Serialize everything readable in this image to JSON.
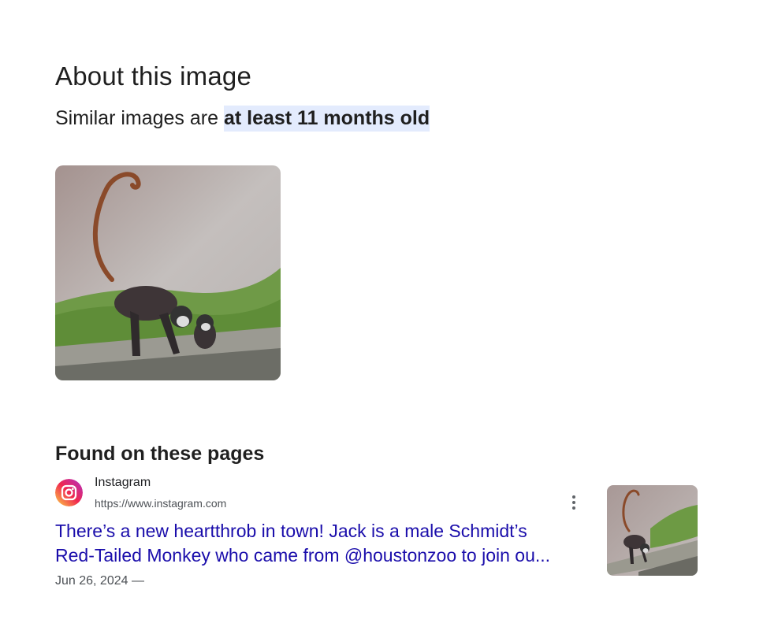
{
  "page": {
    "title": "About this image",
    "age_prefix": "Similar images are ",
    "age_highlight": "at least 11 months old",
    "found_title": "Found on these pages"
  },
  "main_image": {
    "icon": "monkey-photo"
  },
  "results": [
    {
      "source_name": "Instagram",
      "source_url": "https://www.instagram.com",
      "favicon": "instagram-icon",
      "title_line1": "There’s a new heartthrob in town! Jack is a male Schmidt’s",
      "title_line2": "Red-Tailed Monkey who came from @houstonzoo to join ou...",
      "date": "Jun 26, 2024 —",
      "more_icon": "more-vert-icon"
    }
  ],
  "colors": {
    "link": "#1a0dab",
    "highlight": "#e3ebfd",
    "text": "#1f1f1f",
    "secondary": "#4d5156"
  }
}
